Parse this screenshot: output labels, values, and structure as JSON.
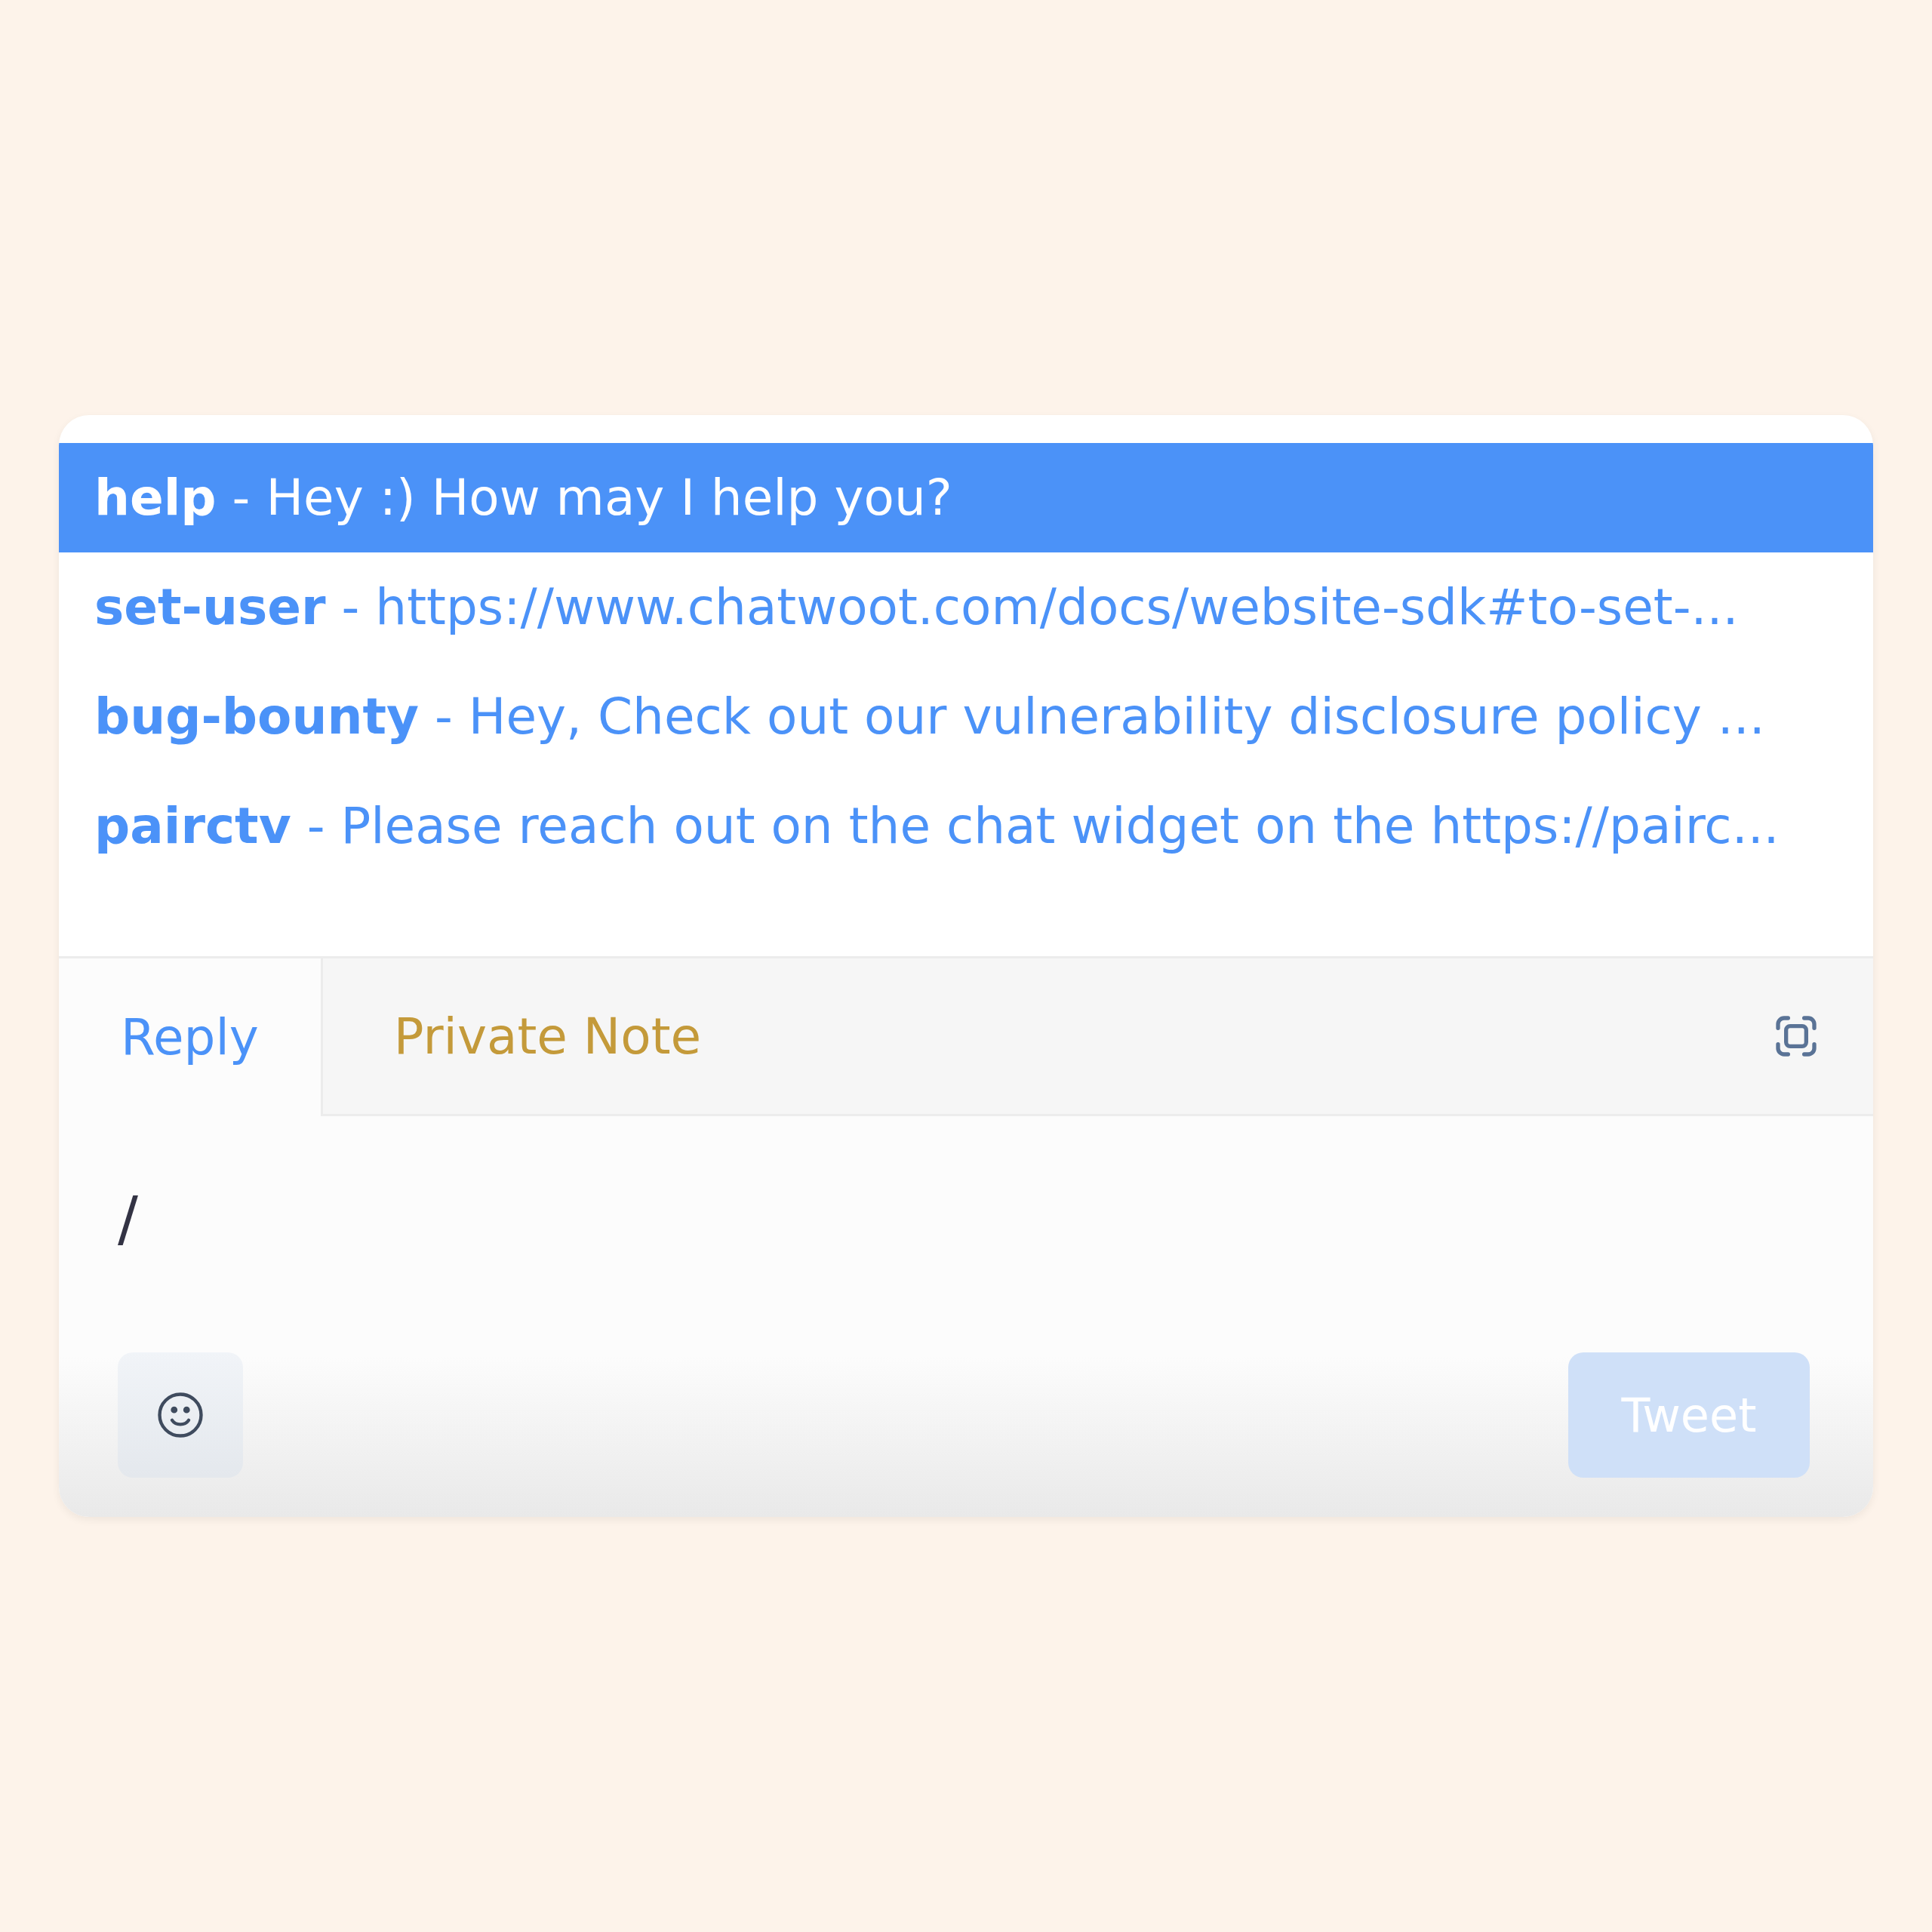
{
  "suggestions": [
    {
      "text": "**help** - Hey :) How may I help you?",
      "selected": true
    },
    {
      "text": "**set-user** - https://www.chatwoot.com/docs/website-sdk#to-set-...",
      "selected": false
    },
    {
      "text": "**bug-bounty** - Hey, Check out our vulnerability disclosure policy ...",
      "selected": false
    },
    {
      "text": "**pairctv** - Please reach out on the chat widget on the https://pairc...",
      "selected": false
    }
  ],
  "tabs": [
    {
      "label": "Reply",
      "kind": "reply",
      "selected": true
    },
    {
      "label": "Private Note",
      "kind": "note",
      "selected": false
    }
  ],
  "editor": {
    "value": "/"
  },
  "send_button": {
    "label": "Tweet",
    "disabled": true
  }
}
